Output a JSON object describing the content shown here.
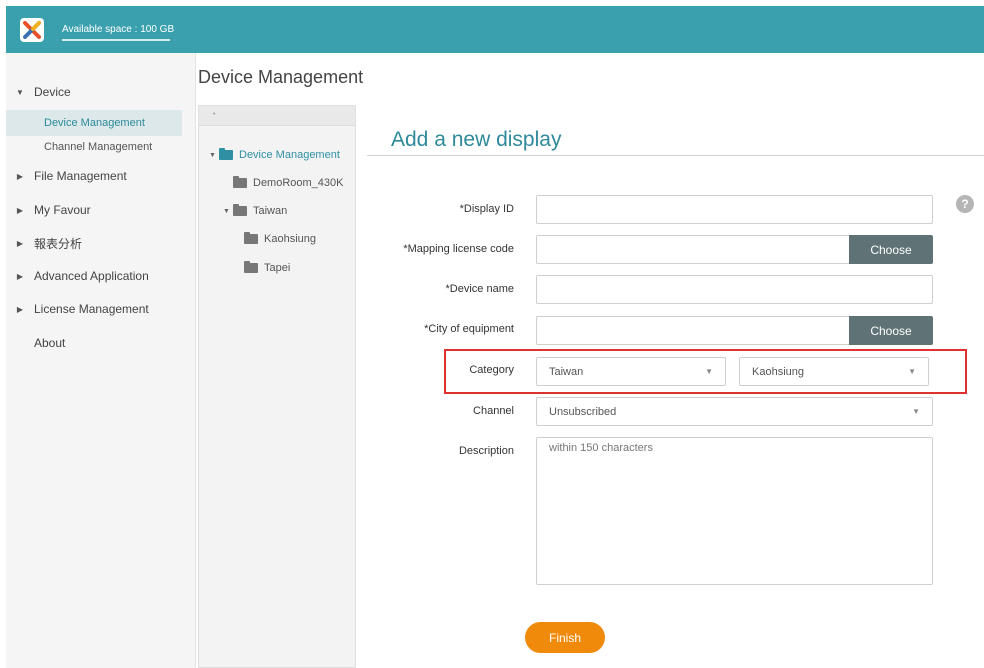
{
  "header": {
    "available_space": "Available space : 100 GB"
  },
  "sidebar": {
    "items": [
      {
        "label": "Device",
        "caret": "▼"
      },
      {
        "label": "Device Management"
      },
      {
        "label": "Channel Management"
      },
      {
        "label": "File Management",
        "caret": "▶"
      },
      {
        "label": "My Favour",
        "caret": "▶"
      },
      {
        "label": "報表分析",
        "caret": "▶"
      },
      {
        "label": "Advanced Application",
        "caret": "▶"
      },
      {
        "label": "License Management",
        "caret": "▶"
      },
      {
        "label": "About"
      }
    ]
  },
  "page": {
    "title": "Device Management"
  },
  "tree": {
    "toolbar_glyph": "•",
    "root": {
      "label": "Device Management",
      "toggle": "▼"
    },
    "items": [
      {
        "label": "DemoRoom_430K"
      },
      {
        "label": "Taiwan",
        "toggle": "▼"
      },
      {
        "label": "Kaohsiung"
      },
      {
        "label": "Tapei"
      }
    ]
  },
  "form": {
    "title": "Add a new display",
    "fields": {
      "display_id": {
        "label": "*Display ID",
        "value": ""
      },
      "mapping_license": {
        "label": "*Mapping license code",
        "value": "",
        "button": "Choose"
      },
      "device_name": {
        "label": "*Device name",
        "value": ""
      },
      "city": {
        "label": "*City of equipment",
        "value": "",
        "button": "Choose"
      },
      "category": {
        "label": "Category",
        "value1": "Taiwan",
        "value2": "Kaohsiung"
      },
      "channel": {
        "label": "Channel",
        "value": "Unsubscribed"
      },
      "description": {
        "label": "Description",
        "placeholder": "within 150 characters"
      }
    },
    "help_glyph": "?",
    "finish_label": "Finish"
  },
  "icons": {
    "dropdown_arrow": "▼"
  },
  "colors": {
    "topbar": "#3aa0ae",
    "accent": "#2e8a9a",
    "choose_button": "#5f7376",
    "finish_button": "#f08a0a",
    "highlight": "#e03131"
  }
}
